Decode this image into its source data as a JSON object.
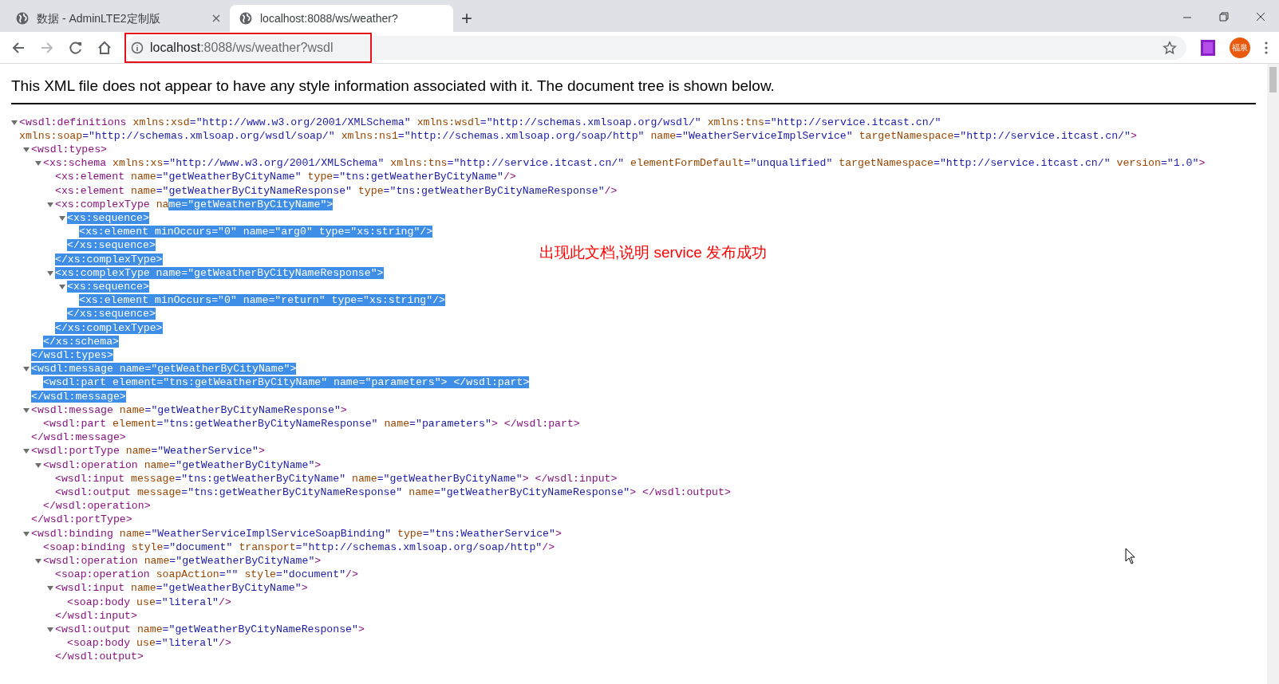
{
  "tabs": [
    {
      "title": "数据 - AdminLTE2定制版",
      "selected": false
    },
    {
      "title": "localhost:8088/ws/weather?",
      "selected": true
    }
  ],
  "new_tab": "+",
  "address_bar": {
    "host": "localhost",
    "path": ":8088/ws/weather?wsdl"
  },
  "profile": {
    "initials": "福泉"
  },
  "info_message": "This XML file does not appear to have any style information associated with it. The document tree is shown below.",
  "annotation": "出现此文档,说明 service 发布成功",
  "xml": {
    "expanded": true,
    "open": [
      {
        "text": "<wsdl:definitions xmlns:xsd=\"http://www.w3.org/2001/XMLSchema\" xmlns:wsdl=\"http://schemas.xmlsoap.org/wsdl/\" xmlns:tns=\"http://service.itcast.cn/\" xmlns:soap=\"http://schemas.xmlsoap.org/wsdl/soap/\" xmlns:ns1=\"http://schemas.xmlsoap.org/soap/http\" name=\"WeatherServiceImplService\" targetNamespace=\"http://service.itcast.cn/\">",
        "selected": false
      }
    ],
    "children": [
      {
        "expanded": true,
        "open": [
          {
            "text": "<wsdl:types>",
            "selected": false
          }
        ],
        "children": [
          {
            "expanded": true,
            "open": [
              {
                "text": "<xs:schema xmlns:xs=\"http://www.w3.org/2001/XMLSchema\" xmlns:tns=\"http://service.itcast.cn/\" elementFormDefault=\"unqualified\" targetNamespace=\"http://service.itcast.cn/\" version=\"1.0\">",
                "selected": false
              }
            ],
            "children": [
              {
                "line": [
                  {
                    "text": "<xs:element name=\"getWeatherByCityName\" type=\"tns:getWeatherByCityName\"/>",
                    "selected": false
                  }
                ]
              },
              {
                "line": [
                  {
                    "text": "<xs:element name=\"getWeatherByCityNameResponse\" type=\"tns:getWeatherByCityNameResponse\"/>",
                    "selected": false
                  }
                ]
              },
              {
                "expanded": true,
                "open": [
                  {
                    "text": "<xs:complexType na",
                    "selected": false
                  },
                  {
                    "text": "me=\"getWeatherByCityName\">",
                    "selected": true
                  }
                ],
                "children": [
                  {
                    "expanded": true,
                    "open": [
                      {
                        "text": "<xs:sequence>",
                        "selected": true
                      }
                    ],
                    "children": [
                      {
                        "line": [
                          {
                            "text": "<xs:element minOccurs=\"0\" name=\"arg0\" type=\"xs:string\"/>",
                            "selected": true
                          }
                        ]
                      }
                    ],
                    "close": [
                      {
                        "text": "</xs:sequence>",
                        "selected": true
                      }
                    ]
                  }
                ],
                "close": [
                  {
                    "text": "</xs:complexType>",
                    "selected": true
                  }
                ]
              },
              {
                "expanded": true,
                "open": [
                  {
                    "text": "<xs:complexType name=\"getWeatherByCityNameResponse\">",
                    "selected": true
                  }
                ],
                "children": [
                  {
                    "expanded": true,
                    "open": [
                      {
                        "text": "<xs:sequence>",
                        "selected": true
                      }
                    ],
                    "children": [
                      {
                        "line": [
                          {
                            "text": "<xs:element minOccurs=\"0\" name=\"return\" type=\"xs:string\"/>",
                            "selected": true
                          }
                        ]
                      }
                    ],
                    "close": [
                      {
                        "text": "</xs:sequence>",
                        "selected": true
                      }
                    ]
                  }
                ],
                "close": [
                  {
                    "text": "</xs:complexType>",
                    "selected": true
                  }
                ]
              }
            ],
            "close": [
              {
                "text": "</xs:schema>",
                "selected": true
              }
            ]
          }
        ],
        "close": [
          {
            "text": "</wsdl:types>",
            "selected": true
          }
        ]
      },
      {
        "expanded": true,
        "open": [
          {
            "text": "<wsdl:message name=\"getWeatherByCityName\">",
            "selected": true
          }
        ],
        "children": [
          {
            "line": [
              {
                "text": "<wsdl:part element=\"tns:getWeatherByCityName\" name=\"parameters\"> </wsdl:part>",
                "selected": true
              }
            ]
          }
        ],
        "close": [
          {
            "text": "</wsdl:message>",
            "selected": true
          }
        ]
      },
      {
        "expanded": true,
        "open": [
          {
            "text": "<wsdl:message name=\"getWeatherByCityNameResponse\">",
            "selected": false
          }
        ],
        "children": [
          {
            "line": [
              {
                "text": "<wsdl:part element=\"tns:getWeatherByCityNameResponse\" name=\"parameters\"> </wsdl:part>",
                "selected": false
              }
            ]
          }
        ],
        "close": [
          {
            "text": "</wsdl:message>",
            "selected": false
          }
        ]
      },
      {
        "expanded": true,
        "open": [
          {
            "text": "<wsdl:portType name=\"WeatherService\">",
            "selected": false
          }
        ],
        "children": [
          {
            "expanded": true,
            "open": [
              {
                "text": "<wsdl:operation name=\"getWeatherByCityName\">",
                "selected": false
              }
            ],
            "children": [
              {
                "line": [
                  {
                    "text": "<wsdl:input message=\"tns:getWeatherByCityName\" name=\"getWeatherByCityName\"> </wsdl:input>",
                    "selected": false
                  }
                ]
              },
              {
                "line": [
                  {
                    "text": "<wsdl:output message=\"tns:getWeatherByCityNameResponse\" name=\"getWeatherByCityNameResponse\"> </wsdl:output>",
                    "selected": false
                  }
                ]
              }
            ],
            "close": [
              {
                "text": "</wsdl:operation>",
                "selected": false
              }
            ]
          }
        ],
        "close": [
          {
            "text": "</wsdl:portType>",
            "selected": false
          }
        ]
      },
      {
        "expanded": true,
        "open": [
          {
            "text": "<wsdl:binding name=\"WeatherServiceImplServiceSoapBinding\" type=\"tns:WeatherService\">",
            "selected": false
          }
        ],
        "children": [
          {
            "line": [
              {
                "text": "<soap:binding style=\"document\" transport=\"http://schemas.xmlsoap.org/soap/http\"/>",
                "selected": false
              }
            ]
          },
          {
            "expanded": true,
            "open": [
              {
                "text": "<wsdl:operation name=\"getWeatherByCityName\">",
                "selected": false
              }
            ],
            "children": [
              {
                "line": [
                  {
                    "text": "<soap:operation soapAction=\"\" style=\"document\"/>",
                    "selected": false
                  }
                ]
              },
              {
                "expanded": true,
                "open": [
                  {
                    "text": "<wsdl:input name=\"getWeatherByCityName\">",
                    "selected": false
                  }
                ],
                "children": [
                  {
                    "line": [
                      {
                        "text": "<soap:body use=\"literal\"/>",
                        "selected": false
                      }
                    ]
                  }
                ],
                "close": [
                  {
                    "text": "</wsdl:input>",
                    "selected": false
                  }
                ]
              },
              {
                "expanded": true,
                "open": [
                  {
                    "text": "<wsdl:output name=\"getWeatherByCityNameResponse\">",
                    "selected": false
                  }
                ],
                "children": [
                  {
                    "line": [
                      {
                        "text": "<soap:body use=\"literal\"/>",
                        "selected": false
                      }
                    ]
                  }
                ],
                "close": [
                  {
                    "text": "</wsdl:output>",
                    "selected": false
                  }
                ]
              }
            ]
          }
        ]
      }
    ]
  }
}
